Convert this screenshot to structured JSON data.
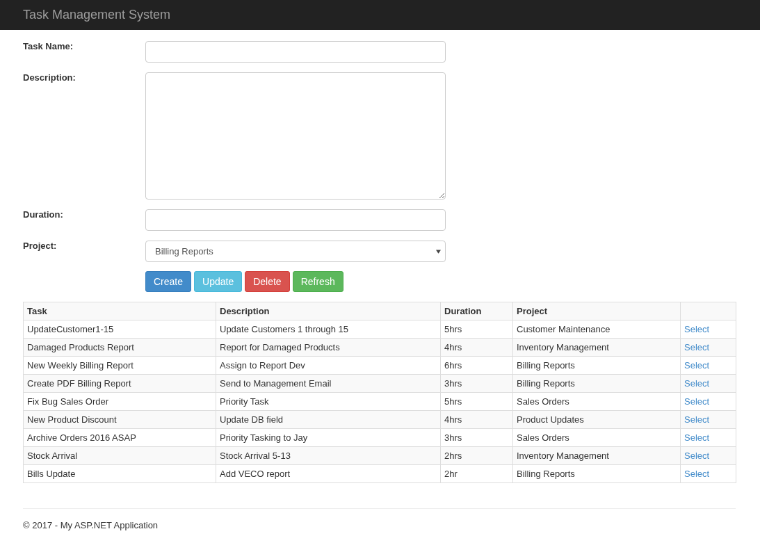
{
  "navbar": {
    "brand": "Task Management System"
  },
  "form": {
    "fields": [
      {
        "kind": "text",
        "label": "Task Name:"
      },
      {
        "kind": "textarea",
        "label": "Description:"
      },
      {
        "kind": "text",
        "label": "Duration:"
      },
      {
        "kind": "select",
        "label": "Project:",
        "value": "Billing Reports"
      }
    ],
    "buttons": [
      {
        "label": "Create",
        "kind": "primary"
      },
      {
        "label": "Update",
        "kind": "info"
      },
      {
        "label": "Delete",
        "kind": "danger"
      },
      {
        "label": "Refresh",
        "kind": "success"
      }
    ]
  },
  "table": {
    "columns": [
      "Task",
      "Description",
      "Duration",
      "Project"
    ],
    "rows": [
      [
        "UpdateCustomer1-15",
        "Update Customers 1 through 15",
        "5hrs",
        "Customer Maintenance",
        "Select"
      ],
      [
        "Damaged Products Report",
        "Report for Damaged Products",
        "4hrs",
        "Inventory Management",
        "Select"
      ],
      [
        "New Weekly Billing Report",
        "Assign to Report Dev",
        "6hrs",
        "Billing Reports",
        "Select"
      ],
      [
        "Create PDF Billing Report",
        "Send to Management Email",
        "3hrs",
        "Billing Reports",
        "Select"
      ],
      [
        "Fix Bug Sales Order",
        "Priority Task",
        "5hrs",
        "Sales Orders",
        "Select"
      ],
      [
        "New Product Discount",
        "Update DB field",
        "4hrs",
        "Product Updates",
        "Select"
      ],
      [
        "Archive Orders 2016 ASAP",
        "Priority Tasking to Jay",
        "3hrs",
        "Sales Orders",
        "Select"
      ],
      [
        "Stock Arrival",
        "Stock Arrival 5-13",
        "2hrs",
        "Inventory Management",
        "Select"
      ],
      [
        "Bills Update",
        "Add VECO report",
        "2hr",
        "Billing Reports",
        "Select"
      ]
    ]
  },
  "footer": {
    "text": "© 2017 - My ASP.NET Application"
  }
}
